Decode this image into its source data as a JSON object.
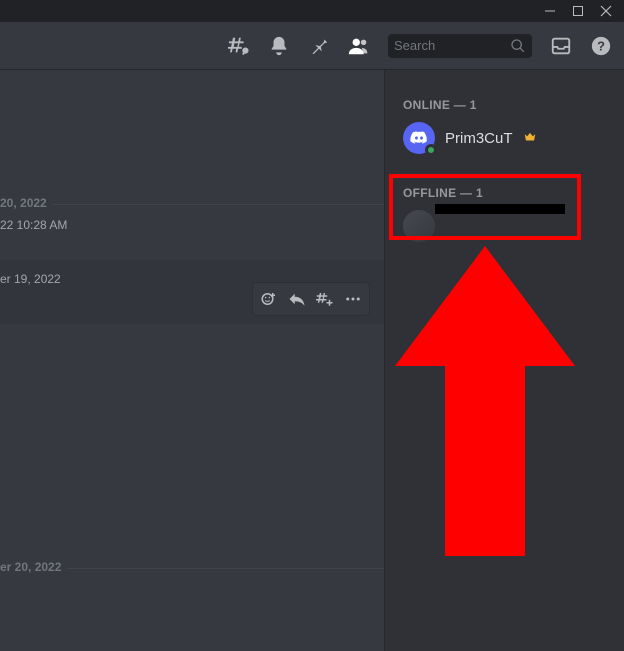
{
  "window": {
    "minimize": "–",
    "maximize": "☐",
    "close": "✕"
  },
  "toolbar": {
    "search_placeholder": "Search"
  },
  "chat": {
    "divider1": "20, 2022",
    "ts1": "22 10:28 AM",
    "divider2": "er 19, 2022",
    "divider3": "er 20, 2022"
  },
  "members": {
    "online_head": "ONLINE — 1",
    "offline_head": "OFFLINE — 1",
    "online": [
      {
        "name": "Prim3CuT",
        "owner": true
      }
    ],
    "offline": [
      {
        "name": ""
      }
    ]
  }
}
